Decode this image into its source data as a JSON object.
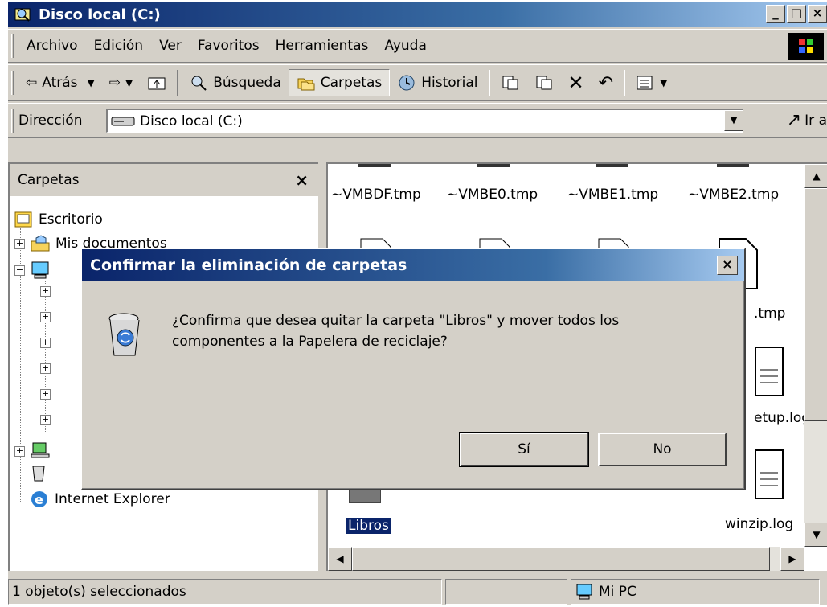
{
  "window": {
    "title": "Disco local (C:)",
    "buttons": [
      "_",
      "□",
      "×"
    ]
  },
  "menu": [
    "Archivo",
    "Edición",
    "Ver",
    "Favoritos",
    "Herramientas",
    "Ayuda"
  ],
  "toolbar": {
    "back": "Atrás",
    "search": "Búsqueda",
    "folders": "Carpetas",
    "history": "Historial"
  },
  "address": {
    "label": "Dirección",
    "value": "Disco local (C:)",
    "go": "Ir a"
  },
  "folders": {
    "header": "Carpetas",
    "close": "×",
    "items": [
      "Escritorio",
      "Mis documentos",
      "Internet Explorer"
    ]
  },
  "files": {
    "items": [
      "~VMBDF.tmp",
      "~VMBE0.tmp",
      "~VMBE1.tmp",
      "~VMBE2.tmp",
      ".tmp",
      "etup.log",
      "winzip.log",
      "Libros"
    ]
  },
  "status": {
    "selection": "1 objeto(s) seleccionados",
    "zone": "Mi PC"
  },
  "dialog": {
    "title": "Confirmar la eliminación de carpetas",
    "close": "×",
    "message_line1": "¿Confirma que desea quitar la carpeta \"Libros\" y mover todos los",
    "message_line2": "componentes a la Papelera de reciclaje?",
    "yes": "Sí",
    "no": "No"
  },
  "colors": {
    "title_start": "#0a246a",
    "title_end": "#a6caf0",
    "face": "#d4d0c8",
    "selection": "#0a246a"
  }
}
